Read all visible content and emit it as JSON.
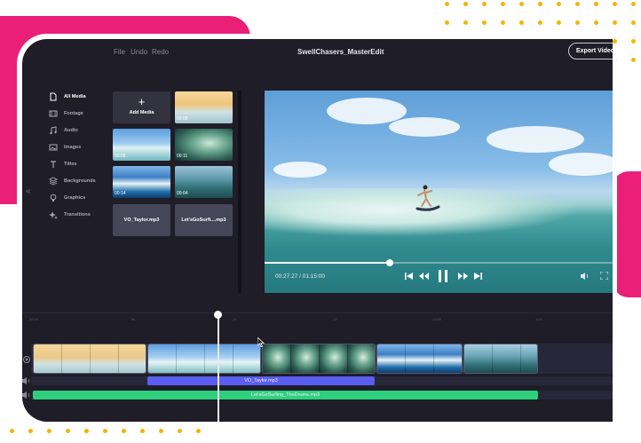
{
  "menu": {
    "file": "File",
    "undo": "Undo",
    "redo": "Redo"
  },
  "project_title": "SwellChasers_MasterEdit",
  "export_label": "Export Video",
  "sidebar": {
    "items": [
      {
        "label": "All Media",
        "icon": "file-icon",
        "active": true
      },
      {
        "label": "Footage",
        "icon": "film-icon"
      },
      {
        "label": "Audio",
        "icon": "music-note-icon"
      },
      {
        "label": "Images",
        "icon": "image-icon"
      },
      {
        "label": "Titles",
        "icon": "text-icon"
      },
      {
        "label": "Backgrounds",
        "icon": "layers-icon"
      },
      {
        "label": "Graphics",
        "icon": "lightbulb-icon"
      },
      {
        "label": "Transitions",
        "icon": "sparkle-icon"
      }
    ]
  },
  "media": {
    "add_label": "Add Media",
    "clips": [
      {
        "duration": "00:08"
      },
      {
        "duration": "00:06"
      },
      {
        "duration": "00:11"
      },
      {
        "duration": "00:14"
      },
      {
        "duration": "00:04"
      }
    ],
    "audio": [
      {
        "label": "VO_Taylor.mp3"
      },
      {
        "label": "Let'sGoSurfi....mp3"
      }
    ]
  },
  "player": {
    "timecode": "00:27.27 / 01:15:00",
    "progress": 0.36
  },
  "timeline": {
    "ruler": [
      "00:00",
      "5s",
      "10",
      "15",
      "20/30",
      "1:15"
    ],
    "voice_clip": "VO_Taylor.mp3",
    "music_clip": "Let'sGoSurfing_TheDrums.mp3"
  },
  "colors": {
    "accent_pink": "#ea1f78",
    "dots_yellow": "#f4b400",
    "app_bg": "#1e1d28",
    "voice_track": "#5a5ef0",
    "music_track": "#2ecf7d"
  }
}
